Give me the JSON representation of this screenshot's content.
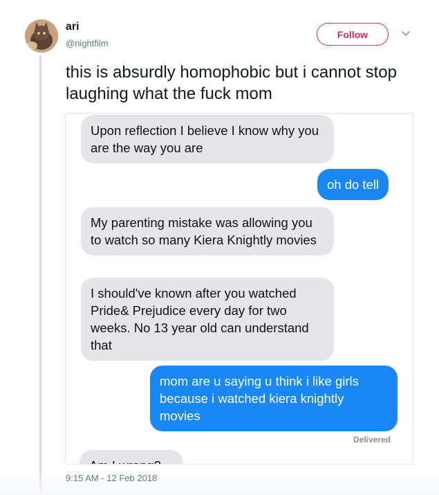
{
  "user": {
    "display_name": "ari",
    "handle": "@nightfilm"
  },
  "follow_label": "Follow",
  "tweet_text": "this is absurdly homophobic but i cannot stop laughing what the fuck mom",
  "messages": [
    {
      "direction": "incoming",
      "text": "Upon reflection I believe I know why you are the way you are"
    },
    {
      "direction": "outgoing",
      "text": "oh do tell"
    },
    {
      "direction": "incoming",
      "text": "My parenting mistake was allowing you to watch so many Kiera Knightly movies"
    },
    {
      "direction": "incoming",
      "text": "I should've known after you watched Pride& Prejudice every day for two weeks. No 13 year old can understand that"
    },
    {
      "direction": "outgoing",
      "text": "mom are u saying u think i like girls because i watched kiera knightly movies"
    },
    {
      "direction": "incoming",
      "text": "Am I wrong?"
    }
  ],
  "delivered_label": "Delivered",
  "timestamp": "9:15 AM - 12 Feb 2018",
  "colors": {
    "follow": "#e0245e",
    "outgoing_bubble": "#1a87f7",
    "incoming_bubble": "#e5e5ea",
    "thread_line": "#f8c9d8"
  }
}
